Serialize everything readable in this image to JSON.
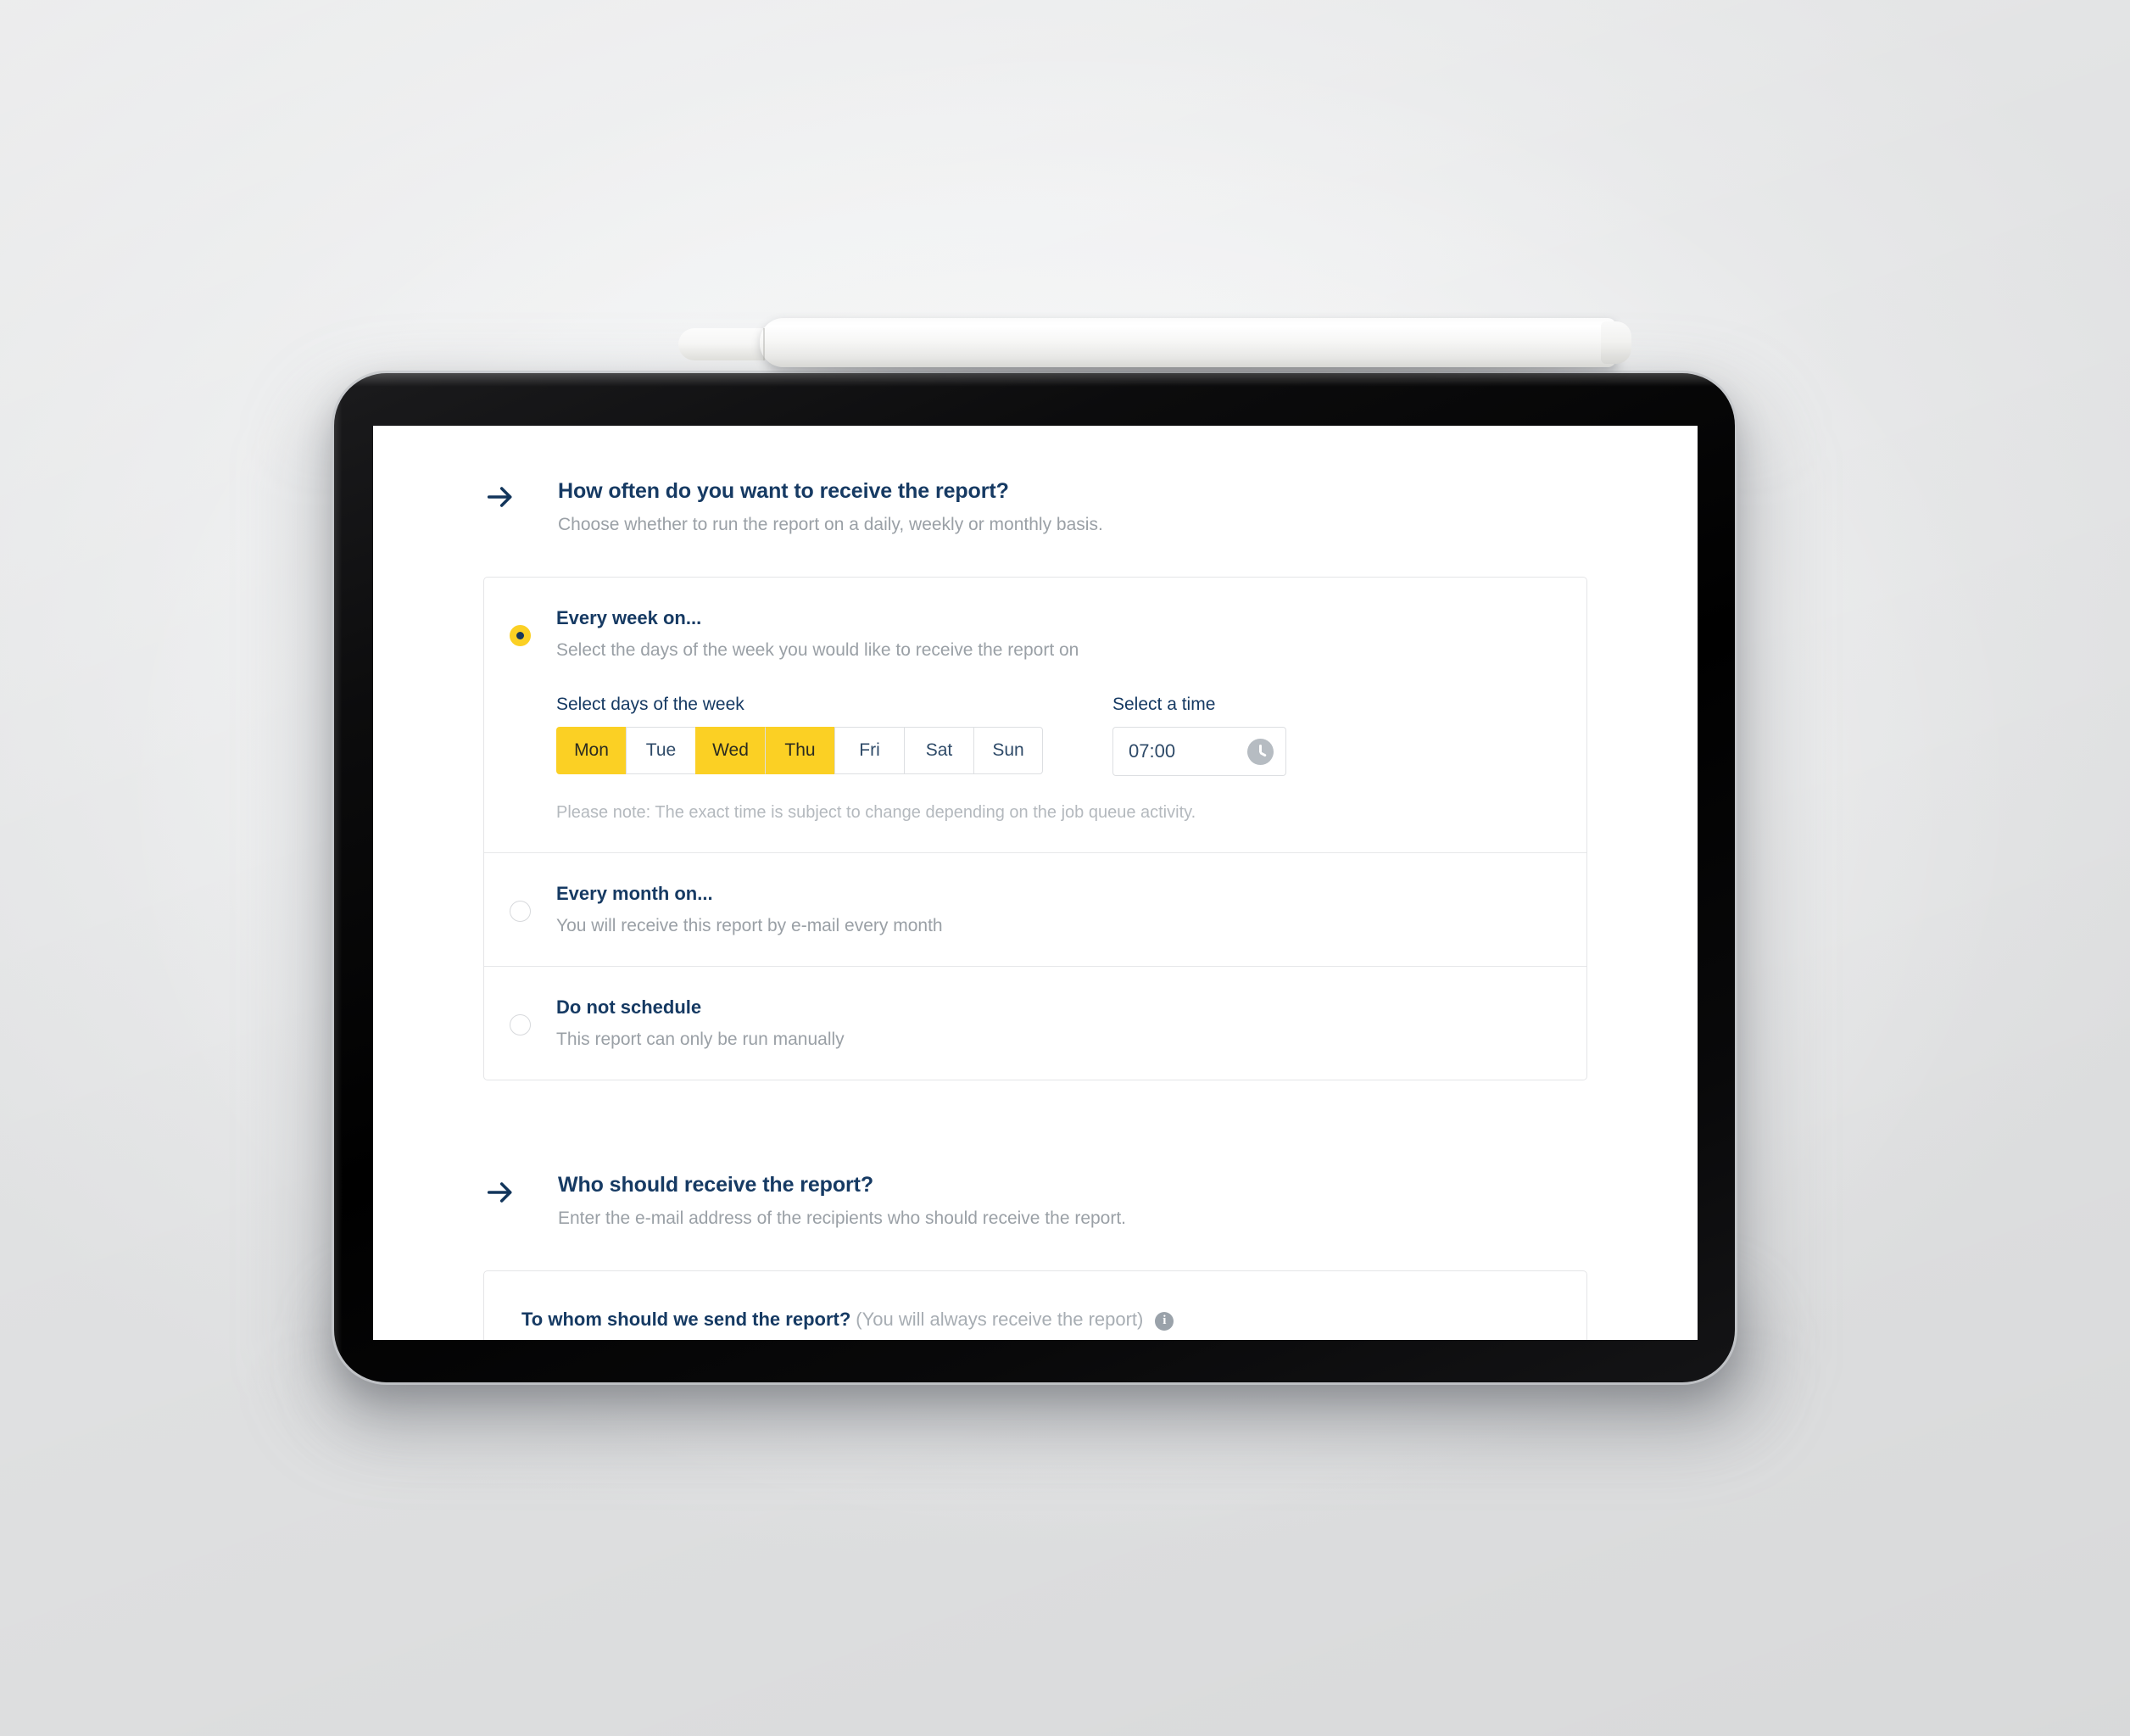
{
  "device": {
    "type": "tablet",
    "stylus_present": true
  },
  "sections": [
    {
      "icon": "arrow-right-icon",
      "title": "How often do you want to receive the report?",
      "subtitle": "Choose whether to run the report on a daily, weekly or monthly basis."
    },
    {
      "icon": "arrow-right-icon",
      "title": "Who should receive the report?",
      "subtitle": "Enter the e-mail address of the recipients who should receive the report."
    }
  ],
  "schedule": {
    "options": [
      {
        "id": "every-week",
        "title": "Every week on...",
        "description": "Select the days of the week you would like to receive the report on",
        "selected": true
      },
      {
        "id": "every-month",
        "title": "Every month on...",
        "description": "You will receive this report by e-mail every month",
        "selected": false
      },
      {
        "id": "do-not-schedule",
        "title": "Do not schedule",
        "description": "This report can only be run manually",
        "selected": false
      }
    ],
    "days_label": "Select days of the week",
    "days": [
      {
        "label": "Mon",
        "selected": true
      },
      {
        "label": "Tue",
        "selected": false
      },
      {
        "label": "Wed",
        "selected": true
      },
      {
        "label": "Thu",
        "selected": true
      },
      {
        "label": "Fri",
        "selected": false
      },
      {
        "label": "Sat",
        "selected": false
      },
      {
        "label": "Sun",
        "selected": false
      }
    ],
    "time_label": "Select a time",
    "time_value": "07:00",
    "time_icon": "clock-icon",
    "note": "Please note: The exact time is subject to change depending on the job queue activity."
  },
  "recipients": {
    "question": "To whom should we send the report?",
    "hint": "(You will always receive the report)",
    "info_icon": "info-icon"
  },
  "colors": {
    "accent_yellow": "#FBD024",
    "heading_navy": "#163A63",
    "muted_grey": "#9AA0A6",
    "border_grey": "#E4E5E7",
    "card_white": "#FFFFFF"
  }
}
